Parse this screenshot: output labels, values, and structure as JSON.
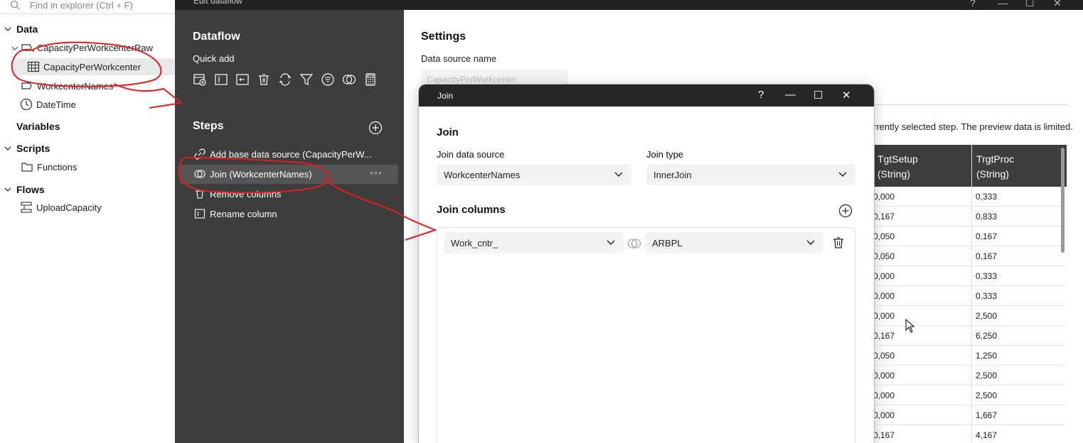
{
  "explorer": {
    "search_placeholder": "Find in explorer (Ctrl + F)",
    "sections": {
      "data": "Data",
      "variables": "Variables",
      "scripts": "Scripts",
      "flows": "Flows"
    },
    "items": {
      "capacity_raw": "CapacityPerWorkcenterRaw",
      "capacity": "CapacityPerWorkcenter",
      "workcenter_names": "WorkcenterNames",
      "datetime": "DateTime",
      "functions": "Functions",
      "upload_capacity": "UploadCapacity"
    }
  },
  "window": {
    "title": "Edit dataflow"
  },
  "dataflow": {
    "title": "Dataflow",
    "quick_add": "Quick add",
    "steps_title": "Steps",
    "steps": [
      {
        "label": "Add base data source (CapacityPerW..."
      },
      {
        "label": "Join (WorkcenterNames)"
      },
      {
        "label": "Remove columns"
      },
      {
        "label": "Rename column"
      }
    ],
    "step_more": "◦◦◦"
  },
  "settings": {
    "title": "Settings",
    "data_source_label": "Data source name",
    "data_source_value": "CapacityPerWorkcenter",
    "preview_note": "rrently selected step. The preview data is limited."
  },
  "preview_table": {
    "columns": [
      {
        "name": "TgtSetup",
        "type": "(String)"
      },
      {
        "name": "TrgtProc",
        "type": "(String)"
      }
    ],
    "rows": [
      [
        "0,000",
        "0,333"
      ],
      [
        "0,167",
        "0,833"
      ],
      [
        "0,050",
        "0,167"
      ],
      [
        "0,050",
        "0,167"
      ],
      [
        "0,000",
        "0,333"
      ],
      [
        "0,000",
        "0,333"
      ],
      [
        "0,000",
        "2,500"
      ],
      [
        "0,167",
        "6,250"
      ],
      [
        "0,050",
        "1,250"
      ],
      [
        "0,000",
        "2,500"
      ],
      [
        "0,000",
        "2,500"
      ],
      [
        "0,000",
        "1,667"
      ],
      [
        "0,167",
        "4,167"
      ]
    ]
  },
  "join_dialog": {
    "title": "Join",
    "heading": "Join",
    "join_source_label": "Join data source",
    "join_source_value": "WorkcenterNames",
    "join_type_label": "Join type",
    "join_type_value": "InnerJoin",
    "join_columns_title": "Join columns",
    "left_column": "Work_cntr_",
    "right_column": "ARBPL",
    "help": "?",
    "minimize": "—",
    "maximize": "☐",
    "close": "✕"
  }
}
